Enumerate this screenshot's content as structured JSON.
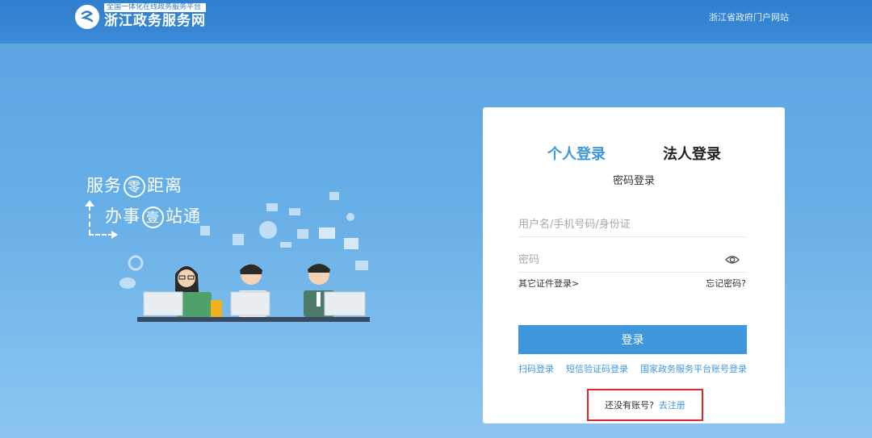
{
  "header": {
    "logo_subtitle": "全国一体化在线政务服务平台",
    "logo_title": "浙江政务服务网",
    "portal_link": "浙江省政府门户网站",
    "bar_color": "#2f7fcf"
  },
  "illustration": {
    "slogan_1_pre": "服务",
    "slogan_1_circle": "零",
    "slogan_1_post": "距离",
    "slogan_2_pre": "办事",
    "slogan_2_circle": "壹",
    "slogan_2_post": "站通"
  },
  "login": {
    "tab_personal": "个人登录",
    "tab_corporate": "法人登录",
    "mode": "密码登录",
    "username_placeholder": "用户名/手机号码/身份证",
    "password_placeholder": "密码",
    "other_cert_login": "其它证件登录>",
    "forgot_password": "忘记密码?",
    "submit": "登录",
    "alt": {
      "qr": "扫码登录",
      "sms": "短信验证码登录",
      "national": "国家政务服务平台账号登录"
    },
    "register_question": "还没有账号?",
    "register_link": "去注册",
    "accent_color": "#3e97dd",
    "highlight_color": "#e3242b"
  }
}
